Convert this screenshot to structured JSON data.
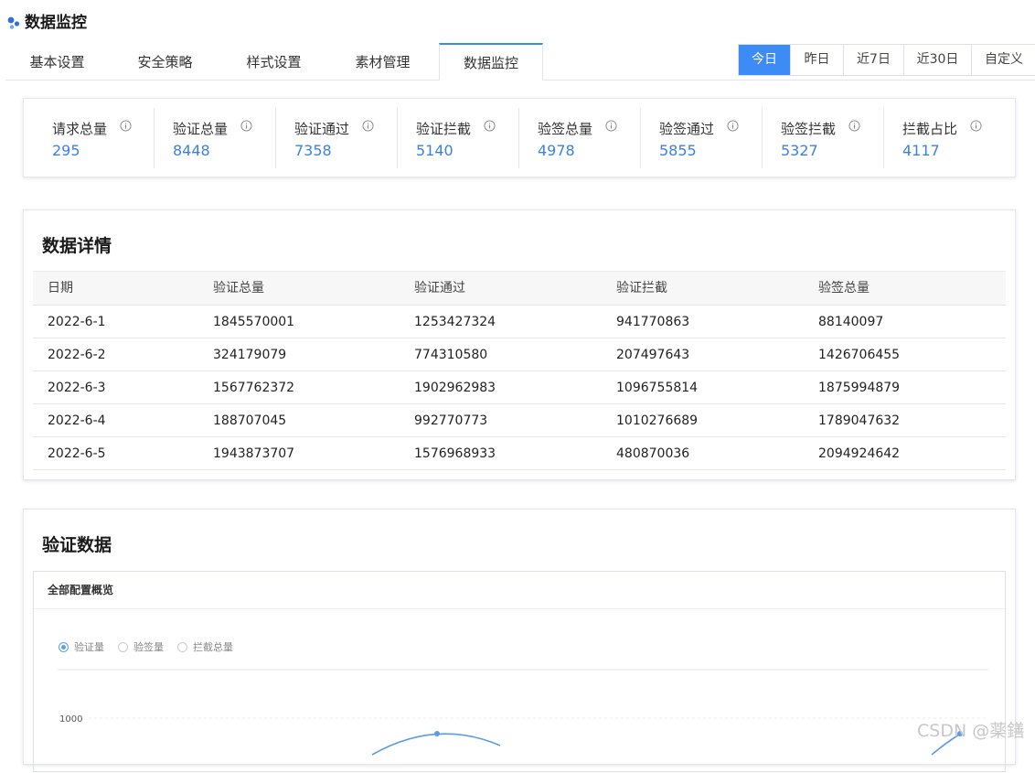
{
  "header": {
    "title": "数据监控"
  },
  "tabs": [
    "基本设置",
    "安全策略",
    "样式设置",
    "素材管理",
    "数据监控"
  ],
  "date_filters": [
    "今日",
    "昨日",
    "近7日",
    "近30日",
    "自定义"
  ],
  "stats": [
    {
      "label": "请求总量",
      "value": "295"
    },
    {
      "label": "验证总量",
      "value": "8448"
    },
    {
      "label": "验证通过",
      "value": "7358"
    },
    {
      "label": "验证拦截",
      "value": "5140"
    },
    {
      "label": "验签总量",
      "value": "4978"
    },
    {
      "label": "验签通过",
      "value": "5855"
    },
    {
      "label": "验签拦截",
      "value": "5327"
    },
    {
      "label": "拦截占比",
      "value": "4117"
    }
  ],
  "detail": {
    "title": "数据详情",
    "columns": [
      "日期",
      "验证总量",
      "验证通过",
      "验证拦截",
      "验签总量"
    ],
    "rows": [
      [
        "2022-6-1",
        "1845570001",
        "1253427324",
        "941770863",
        "88140097"
      ],
      [
        "2022-6-2",
        "324179079",
        "774310580",
        "207497643",
        "1426706455"
      ],
      [
        "2022-6-3",
        "1567762372",
        "1902962983",
        "1096755814",
        "1875994879"
      ],
      [
        "2022-6-4",
        "188707045",
        "992770773",
        "1010276689",
        "1789047632"
      ],
      [
        "2022-6-5",
        "1943873707",
        "1576968933",
        "480870036",
        "2094924642"
      ]
    ]
  },
  "verify": {
    "title": "验证数据",
    "panel_title": "全部配置概览",
    "options": [
      "验证量",
      "验签量",
      "拦截总量"
    ],
    "y_tick": "1000"
  },
  "chart_data": {
    "type": "line",
    "series": [
      {
        "name": "验证量",
        "values": []
      }
    ],
    "y_ticks": [
      "1000"
    ],
    "color": "#5b9bea"
  },
  "watermark": "CSDN @薬鐥"
}
